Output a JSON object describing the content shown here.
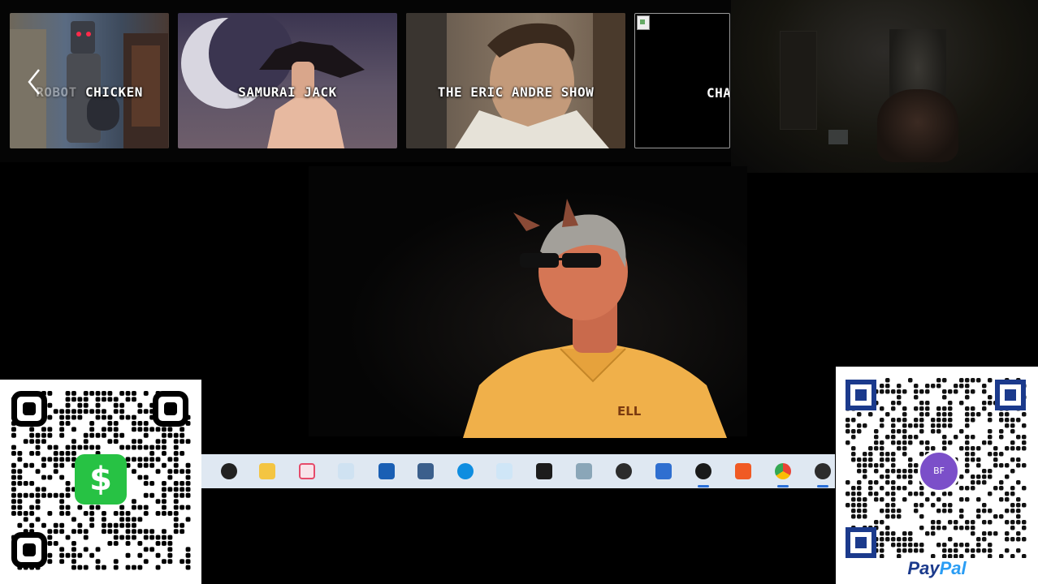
{
  "carousel": {
    "prev_icon": "chevron-left-icon",
    "cards": [
      {
        "title_prefix": "ROBOT",
        "title": "CHICKEN"
      },
      {
        "title": "SAMURAI JACK"
      },
      {
        "title": "THE ERIC ANDRE SHOW"
      },
      {
        "title": "CHA"
      }
    ]
  },
  "video": {
    "shirt_logo": "ELL"
  },
  "taskbar": {
    "icons": [
      {
        "name": "black-blob-icon",
        "color": "#222222"
      },
      {
        "name": "file-explorer-icon",
        "color": "#f4c542"
      },
      {
        "name": "paint-icon",
        "color": "#e64a6a"
      },
      {
        "name": "paint-brush-icon",
        "color": "#5ba4d8"
      },
      {
        "name": "stock-chart-icon",
        "color": "#1a5fb4"
      },
      {
        "name": "calculator-icon",
        "color": "#3b5f8c"
      },
      {
        "name": "edge-browser-icon",
        "color": "#0f8de0"
      },
      {
        "name": "network-icon",
        "color": "#3aa0e0"
      },
      {
        "name": "terminal-icon",
        "color": "#1c1c1c"
      },
      {
        "name": "device-icon",
        "color": "#8aa6b8"
      },
      {
        "name": "obs-icon",
        "color": "#2c2c2c"
      },
      {
        "name": "network-computer-icon",
        "color": "#2f6fd0"
      },
      {
        "name": "media-player-icon",
        "color": "#1a1a1a"
      },
      {
        "name": "brave-browser-icon",
        "color": "#f05a24"
      },
      {
        "name": "chrome-browser-icon",
        "color": "#4285f4"
      },
      {
        "name": "obs-alt-icon",
        "color": "#2c2c2c"
      }
    ]
  },
  "cashapp": {
    "symbol": "$"
  },
  "paypal": {
    "avatar_initials": "BF",
    "logo_pay": "Pay",
    "logo_pal": "Pal"
  }
}
